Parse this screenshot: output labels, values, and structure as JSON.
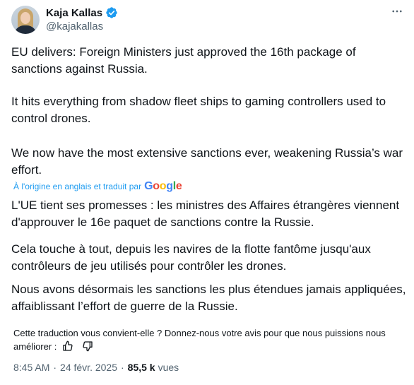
{
  "author": {
    "display_name": "Kaja Kallas",
    "handle": "@kajakallas",
    "verified_badge_color": "#1d9bf0"
  },
  "tweet": {
    "paragraphs": [
      "EU delivers: Foreign Ministers just approved the 16th package of sanctions against Russia.",
      "It hits everything from shadow fleet ships to gaming controllers used to control drones.",
      "We now have the most extensive sanctions ever, weakening Russia’s war effort."
    ]
  },
  "translation": {
    "label": "À l'origine en anglais et traduit par",
    "provider": "Google",
    "paragraphs": [
      "L'UE tient ses promesses : les ministres des Affaires étrangères viennent d'approuver le 16e paquet de sanctions contre la Russie.",
      "Cela touche à tout, depuis les navires de la flotte fantôme jusqu'aux contrôleurs de jeu utilisés pour contrôler les drones.",
      "Nous avons désormais les sanctions les plus étendues jamais appliquées, affaiblissant l’effort de guerre de la Russie."
    ],
    "feedback_prompt": "Cette traduction vous convient-elle ? Donnez-nous votre avis pour que nous puissions nous améliorer :"
  },
  "meta": {
    "time": "8:45 AM",
    "separator": "·",
    "date": "24 févr. 2025",
    "views_count": "85,5 k",
    "views_label": "vues"
  },
  "icons": {
    "more": "more-horizontal-icon",
    "verified": "verified-badge-icon",
    "thumbs_up": "thumbs-up-icon",
    "thumbs_down": "thumbs-down-icon"
  },
  "colors": {
    "link": "#1d9bf0",
    "secondary_text": "#536471",
    "primary_text": "#0f1419"
  }
}
